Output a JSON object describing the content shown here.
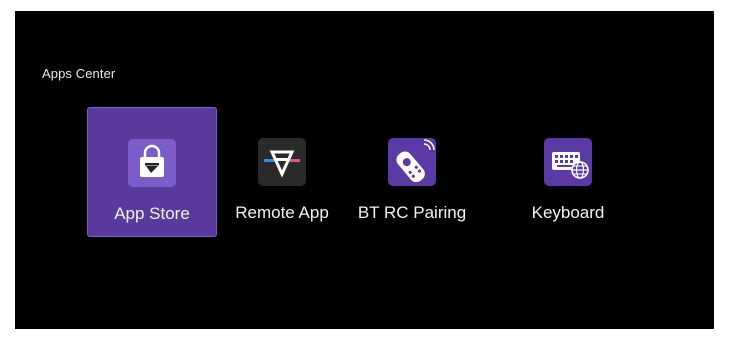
{
  "section": {
    "title": "Apps Center"
  },
  "apps": [
    {
      "label": "App Store",
      "icon": "app-store-bag-icon",
      "focused": true
    },
    {
      "label": "Remote App",
      "icon": "remote-app-logo-icon",
      "focused": false
    },
    {
      "label": "BT RC Pairing",
      "icon": "bluetooth-remote-icon",
      "focused": false
    },
    {
      "label": "Keyboard",
      "icon": "keyboard-globe-icon",
      "focused": false
    }
  ],
  "colors": {
    "background": "#000000",
    "focus_tile": "#5a3a9c",
    "icon_purple": "#5b3aa6",
    "icon_dark": "#2a2a2a",
    "accent_blue": "#2f8fe8",
    "accent_pink": "#e64f9a"
  }
}
